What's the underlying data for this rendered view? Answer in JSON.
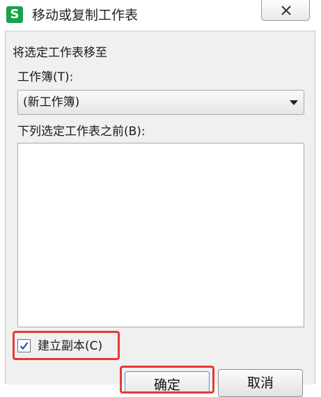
{
  "window": {
    "app_logo": "S",
    "title": "移动或复制工作表"
  },
  "dialog": {
    "move_label": "将选定工作表移至",
    "workbook_label": "工作簿(T):",
    "workbook_selected": "(新工作簿)",
    "before_sheet_label": "下列选定工作表之前(B):",
    "before_sheet_items": [],
    "copy_checkbox": {
      "label": "建立副本(C)",
      "checked": true
    },
    "ok_label": "确定",
    "cancel_label": "取消"
  },
  "colors": {
    "app_logo": "#1aa24a",
    "highlight": "#e53935",
    "dialog_background": "#f0f0f0"
  }
}
